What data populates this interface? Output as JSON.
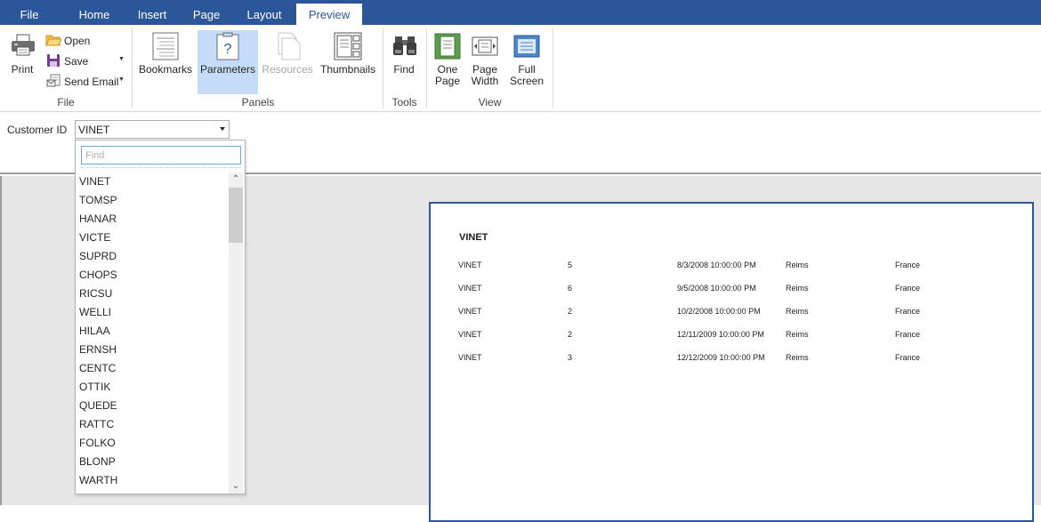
{
  "tabs": {
    "file": "File",
    "home": "Home",
    "insert": "Insert",
    "page": "Page",
    "layout": "Layout",
    "preview": "Preview"
  },
  "ribbon": {
    "file_group": {
      "label": "File",
      "print": "Print",
      "open": "Open",
      "save": "Save",
      "send_email": "Send Email"
    },
    "panels_group": {
      "label": "Panels",
      "bookmarks": "Bookmarks",
      "parameters": "Parameters",
      "resources": "Resources",
      "thumbnails": "Thumbnails"
    },
    "tools_group": {
      "label": "Tools",
      "find": "Find"
    },
    "view_group": {
      "label": "View",
      "one_page_line1": "One",
      "one_page_line2": "Page",
      "page_width_line1": "Page",
      "page_width_line2": "Width",
      "full_screen_line1": "Full",
      "full_screen_line2": "Screen"
    }
  },
  "parameters": {
    "label": "Customer ID",
    "selected": "VINET",
    "find_placeholder": "Find",
    "options": [
      "VINET",
      "TOMSP",
      "HANAR",
      "VICTE",
      "SUPRD",
      "CHOPS",
      "RICSU",
      "WELLI",
      "HILAA",
      "ERNSH",
      "CENTC",
      "OTTIK",
      "QUEDE",
      "RATTC",
      "FOLKO",
      "BLONP",
      "WARTH"
    ]
  },
  "report": {
    "title": "VINET",
    "rows": [
      {
        "customer": "VINET",
        "qty": "5",
        "date": "8/3/2008 10:00:00 PM",
        "city": "Reims",
        "country": "France"
      },
      {
        "customer": "VINET",
        "qty": "6",
        "date": "9/5/2008 10:00:00 PM",
        "city": "Reims",
        "country": "France"
      },
      {
        "customer": "VINET",
        "qty": "2",
        "date": "10/2/2008 10:00:00 PM",
        "city": "Reims",
        "country": "France"
      },
      {
        "customer": "VINET",
        "qty": "2",
        "date": "12/11/2009 10:00:00 PM",
        "city": "Reims",
        "country": "France"
      },
      {
        "customer": "VINET",
        "qty": "3",
        "date": "12/12/2009 10:00:00 PM",
        "city": "Reims",
        "country": "France"
      }
    ]
  },
  "colors": {
    "brand": "#2b579a",
    "pressed": "#c5dcf8"
  }
}
